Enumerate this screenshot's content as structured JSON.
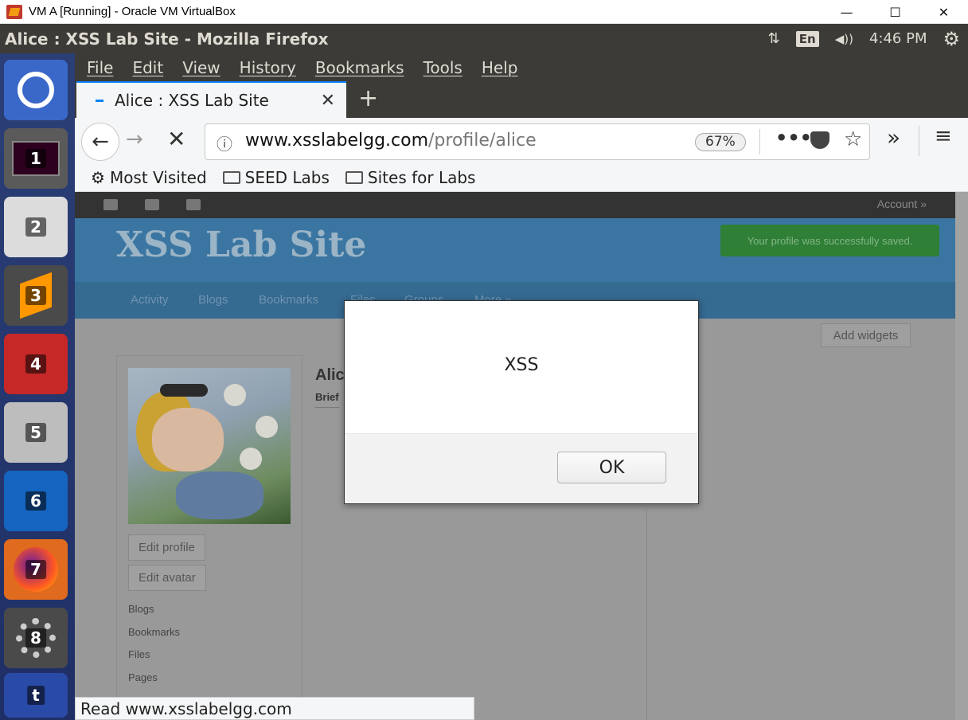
{
  "host_window": {
    "title": "VM A [Running] - Oracle VM VirtualBox",
    "minimize": "—",
    "maximize": "☐",
    "close": "✕"
  },
  "ubuntu_panel": {
    "app_title": "Alice : XSS Lab Site - Mozilla Firefox",
    "network": "⇅",
    "keyboard": "En",
    "volume": "◀))",
    "time": "4:46 PM",
    "settings": "⚙"
  },
  "launcher": {
    "items": [
      "1",
      "2",
      "3",
      "4",
      "5",
      "6",
      "7",
      "8",
      "t"
    ]
  },
  "firefox": {
    "menu": [
      "File",
      "Edit",
      "View",
      "History",
      "Bookmarks",
      "Tools",
      "Help"
    ],
    "tab": {
      "title": "Alice : XSS Lab Site",
      "close": "✕"
    },
    "new_tab": "+",
    "nav": {
      "back": "←",
      "forward": "→",
      "stop": "✕",
      "overflow": "»",
      "menu": "≡"
    },
    "url": {
      "host": "www.xsslabelgg.com",
      "path": "/profile/alice",
      "zoom": "67%",
      "info": "ⓘ",
      "more": "•••",
      "star": "☆"
    },
    "bookmarks": [
      "Most Visited",
      "SEED Labs",
      "Sites for Labs"
    ],
    "status": "Read www.xsslabelgg.com"
  },
  "page": {
    "topbar_account": "Account »",
    "site_title": "XSS Lab Site",
    "saved_message": "Your profile was successfully saved.",
    "nav": [
      "Activity",
      "Blogs",
      "Bookmarks",
      "Files",
      "Groups",
      "More »"
    ],
    "add_widgets": "Add widgets",
    "profile_name": "Alic",
    "profile_brief": "Brief",
    "buttons": [
      "Edit profile",
      "Edit avatar"
    ],
    "links": [
      "Blogs",
      "Bookmarks",
      "Files",
      "Pages"
    ]
  },
  "alert": {
    "message": "XSS",
    "ok": "OK"
  }
}
